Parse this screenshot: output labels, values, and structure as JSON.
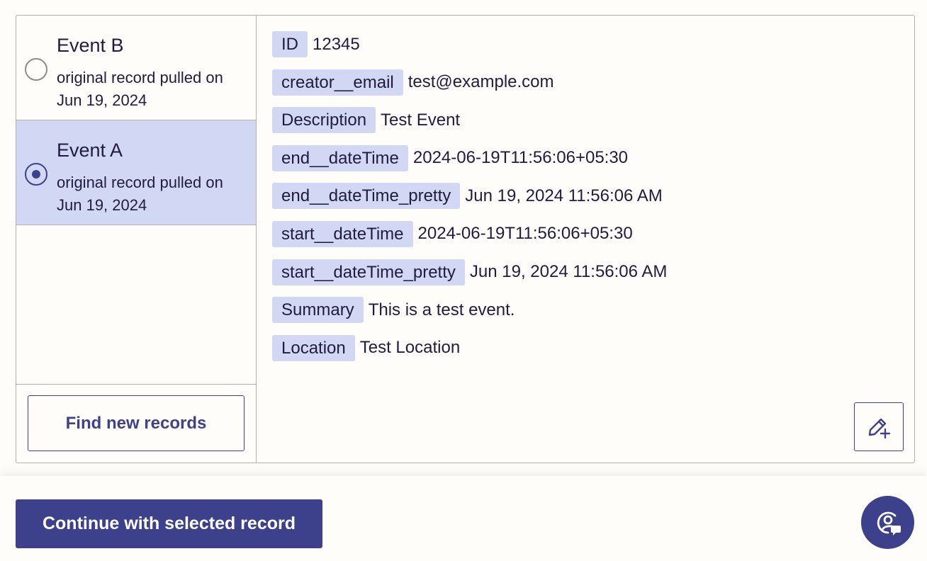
{
  "records": [
    {
      "title": "Event B",
      "subtitle": "original record pulled on Jun 19, 2024",
      "selected": false
    },
    {
      "title": "Event A",
      "subtitle": "original record pulled on Jun 19, 2024",
      "selected": true
    }
  ],
  "find_button_label": "Find new records",
  "fields": [
    {
      "key": "ID",
      "value": "12345"
    },
    {
      "key": "creator__email",
      "value": "test@example.com"
    },
    {
      "key": "Description",
      "value": "Test Event"
    },
    {
      "key": "end__dateTime",
      "value": "2024-06-19T11:56:06+05:30"
    },
    {
      "key": "end__dateTime_pretty",
      "value": "Jun 19, 2024 11:56:06 AM"
    },
    {
      "key": "start__dateTime",
      "value": "2024-06-19T11:56:06+05:30"
    },
    {
      "key": "start__dateTime_pretty",
      "value": "Jun 19, 2024 11:56:06 AM"
    },
    {
      "key": "Summary",
      "value": "This is a test event."
    },
    {
      "key": "Location",
      "value": "Test Location"
    }
  ],
  "continue_button_label": "Continue with selected record",
  "icons": {
    "edit": "edit-add-icon",
    "help": "help-chat-icon"
  },
  "colors": {
    "accent": "#3d418b",
    "selected_bg": "#d2d7f4",
    "key_bg": "#d2d7f4"
  }
}
